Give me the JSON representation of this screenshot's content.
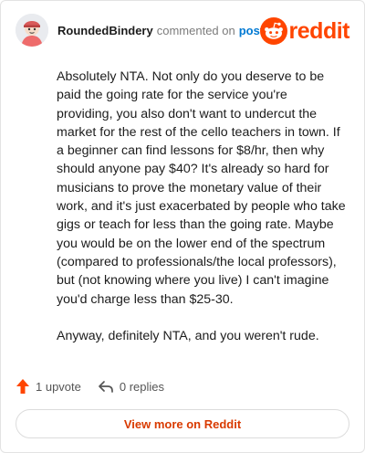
{
  "header": {
    "username": "RoundedBindery",
    "action_text": "commented on",
    "post_link": "post",
    "brand": "reddit"
  },
  "comment": {
    "paragraphs": [
      "Absolutely NTA. Not only do you deserve to be paid the going rate for the service you're providing, you also don't want to undercut the market for the rest of the cello teachers in town. If a beginner can find lessons for $8/hr, then why should anyone pay $40? It's already so hard for musicians to prove the monetary value of their work, and it's just exacerbated by people who take gigs or teach for less than the going rate. Maybe you would be on the lower end of the spectrum (compared to professionals/the local professors), but (not knowing where you live) I can't imagine you'd charge less than $25-30.",
      "Anyway, definitely NTA, and you weren't rude."
    ]
  },
  "actions": {
    "upvote_label": "1 upvote",
    "replies_label": "0 replies"
  },
  "view_more_label": "View more on Reddit",
  "colors": {
    "brand": "#ff4500",
    "link": "#0079d3",
    "upvote": "#ff4500",
    "view_more": "#d93a00"
  },
  "icons": {
    "avatar": "avatar-icon",
    "brand_logo": "reddit-snoo-icon",
    "upvote": "upvote-arrow-icon",
    "reply": "reply-arrow-icon"
  }
}
